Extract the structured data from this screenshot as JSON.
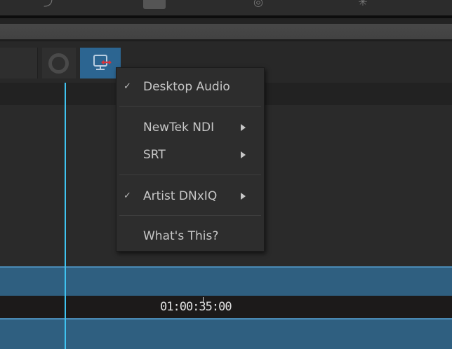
{
  "menu": {
    "items": [
      {
        "label": "Desktop Audio",
        "checked": true,
        "submenu": false
      },
      {
        "label": "NewTek NDI",
        "checked": false,
        "submenu": true
      },
      {
        "label": "SRT",
        "checked": false,
        "submenu": true
      },
      {
        "label": "Artist DNxIQ",
        "checked": true,
        "submenu": true
      },
      {
        "label": "What's This?",
        "checked": false,
        "submenu": false
      }
    ],
    "check_glyph": "✓"
  },
  "timeline": {
    "timecode": "01:00:35:00"
  },
  "colors": {
    "accent": "#2c6591",
    "playhead": "#3fc3f0",
    "track": "#2f5f80"
  }
}
